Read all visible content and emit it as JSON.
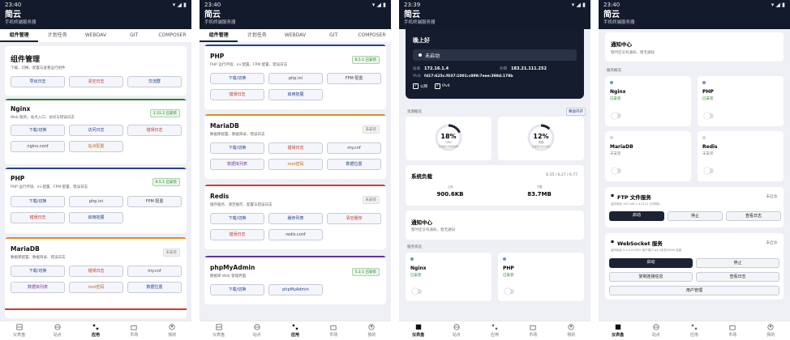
{
  "app": {
    "title": "简云",
    "subtitle": "手机终端服务器"
  },
  "status_times": [
    "23:40",
    "23:40",
    "23:39",
    "23:40"
  ],
  "tabs": [
    "组件管理",
    "计划任务",
    "WEBDAV",
    "GIT",
    "COMPOSER"
  ],
  "nav": [
    "仪表盘",
    "站点",
    "应用",
    "市场",
    "我的"
  ],
  "screen1": {
    "title": "组件管理",
    "desc": "下载、切换、配置与查看运行组件",
    "top_buttons": [
      "导出日志",
      "清空日志",
      "交流群"
    ],
    "nginx": {
      "title": "Nginx",
      "badge": "1.31.2 已安装",
      "desc": "Web 服务、站点入口、访问与错误日志",
      "buttons": [
        "下载/切换",
        "访问日志",
        "错误日志",
        "nginx.conf",
        "站点配置"
      ]
    },
    "php": {
      "title": "PHP",
      "badge": "8.5.1 已安装",
      "desc": "PHP 运行环境、ini 配置、FPM 配置、错误日志",
      "buttons": [
        "下载/切换",
        "php.ini",
        "FPM 配置",
        "错误日志",
        "启用拓展"
      ]
    },
    "mariadb": {
      "title": "MariaDB",
      "badge": "未安装",
      "desc": "数据库配置、数据目录、错误日志",
      "buttons": [
        "下载/切换",
        "错误日志",
        "my.cnf",
        "数据库列表",
        "root密码",
        "数据位置"
      ]
    }
  },
  "screen2": {
    "php": {
      "title": "PHP",
      "badge": "8.5.1 已安装",
      "desc": "PHP 运行环境、ini 配置、FPM 配置、错误日志",
      "buttons": [
        "下载/切换",
        "php.ini",
        "FPM 配置",
        "错误日志",
        "启用拓展"
      ]
    },
    "mariadb": {
      "title": "MariaDB",
      "badge": "未安装",
      "desc": "数据库配置、数据目录、错误日志",
      "buttons": [
        "下载/切换",
        "错误日志",
        "my.cnf",
        "数据库列表",
        "root密码",
        "数据位置"
      ]
    },
    "redis": {
      "title": "Redis",
      "badge": "未安装",
      "desc": "缓存服务、清空缓存、配置与错误日志",
      "buttons": [
        "下载/切换",
        "缓存列表",
        "清空缓存",
        "错误日志",
        "redis.conf"
      ]
    },
    "pma": {
      "title": "phpMyAdmin",
      "badge": "5.2.1 已安装",
      "desc": "数据库 Web 管理界面",
      "buttons": [
        "下载/切换",
        "phpMyAdmin"
      ]
    }
  },
  "screen3": {
    "greeting": "晚上好",
    "run_status": "未启动",
    "lan_label": "局域",
    "lan_ip": "172.16.1.4",
    "pub_label": "外网",
    "pub_ip": "183.21.111.252",
    "ipv6_label": "IPv6",
    "ipv6": "fd17:625c:f037:1001:c899:7eee:3984:178b",
    "check_a": "公网",
    "check_b": "IPv6",
    "res_title": "资源概览",
    "res_link": "释放内存",
    "cpu": {
      "value": "18%",
      "label": "CPU",
      "sub": "已用核心的使用率"
    },
    "mem": {
      "value": "12%",
      "label": "内存",
      "sub": "已使用/总计内存"
    },
    "load_title": "系统负载",
    "load_value": "6.55 / 6.27 / 6.77",
    "up_label": "上传",
    "up": "900.6KB",
    "down_label": "下载",
    "down": "83.7MB",
    "notice_title": "通知中心",
    "notice_desc": "暂时还没有通知，暂无通知",
    "svc_title": "服务状态",
    "svc": [
      {
        "name": "Nginx",
        "state": "已安装"
      },
      {
        "name": "PHP",
        "state": "已安装"
      }
    ]
  },
  "screen4": {
    "notice_title": "通知中心",
    "notice_desc": "暂时还没有通知，暂无通知",
    "svc_title": "服务概况",
    "svc": [
      {
        "name": "Nginx",
        "state": "已安装"
      },
      {
        "name": "PHP",
        "state": "已安装"
      },
      {
        "name": "MariaDB",
        "state": "未安装"
      },
      {
        "name": "Redis",
        "state": "未安装"
      }
    ],
    "ftp": {
      "title": "FTP 文件服务",
      "state": "未启动",
      "desc": "监听地址 192.168.1.4:2121 (已停用)",
      "buttons": [
        "启动",
        "停止",
        "查看日志"
      ]
    },
    "ws": {
      "title": "WebSocket 服务",
      "state": "未启动",
      "desc": "监听地址 0.0.0.0:9502 用户端口 ws://本机:8599 连接",
      "buttons": [
        "启动",
        "停止",
        "复制连接信息",
        "查看日志",
        "用户管理"
      ]
    }
  },
  "colors": {
    "header": "#131a2b",
    "green": "#2e7d32",
    "orange": "#e08a1c",
    "red": "#d33a2c",
    "purple": "#6a2ea0",
    "blue_link": "#27418c"
  }
}
